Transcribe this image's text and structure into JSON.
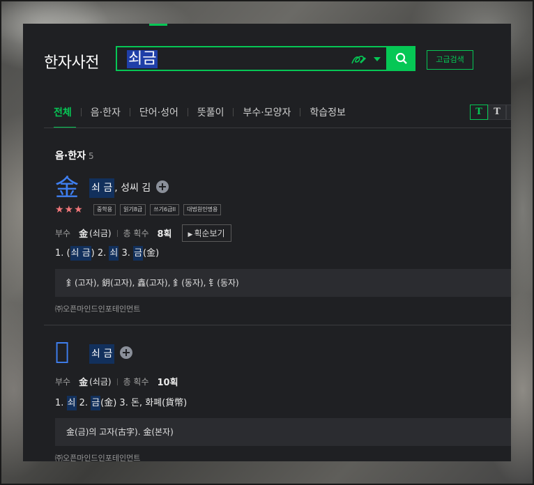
{
  "header": {
    "brand": "한자사전",
    "search_value": "쇠금",
    "advanced_search": "고급검색"
  },
  "tabs": [
    "전체",
    "음·한자",
    "단어·성어",
    "뜻풀이",
    "부수·모양자",
    "학습정보"
  ],
  "font_toggles": [
    "T",
    "T",
    "T"
  ],
  "section": {
    "title": "음·한자",
    "count": "5"
  },
  "entries": [
    {
      "hanja": "金",
      "reading": "쇠 금",
      "extra": ", 성씨 김",
      "stars": "★★★",
      "badges": [
        "중학용",
        "읽기8급",
        "쓰기6급II",
        "대법원인명용"
      ],
      "radical_label": "부수",
      "radical": "金",
      "radical_name": "(쇠금)",
      "strokes_label": "총 획수",
      "strokes": "8획",
      "stroke_button": "획순보기",
      "meanings": {
        "p1": "1. (",
        "w1": "쇠 금",
        "p2": ")  2. ",
        "w2": "쇠",
        "p3": "  3. ",
        "w3": "금",
        "p4": "(金)"
      },
      "variants": "釒(고자), 鈅(고자), 鑫(고자), 釒(동자), 钅(동자)",
      "source": "㈜오픈마인드인포테인먼트"
    },
    {
      "hanja": "𨥁",
      "reading": "쇠 금",
      "radical_label": "부수",
      "radical": "金",
      "radical_name": "(쇠금)",
      "strokes_label": "총 획수",
      "strokes": "10획",
      "meanings": {
        "p1": "1. ",
        "w1": "쇠",
        "p2": "  2. ",
        "w2": "금",
        "p3": "(金)  3. 돈, 화폐(貨幣)"
      },
      "variants": "金(금)의 고자(古字). 金(본자)",
      "source": "㈜오픈마인드인포테인먼트"
    }
  ],
  "colors": {
    "accent": "#06c755",
    "hanja": "#3f7ff0",
    "panel": "#1f2023",
    "highlight": "#12305c"
  }
}
